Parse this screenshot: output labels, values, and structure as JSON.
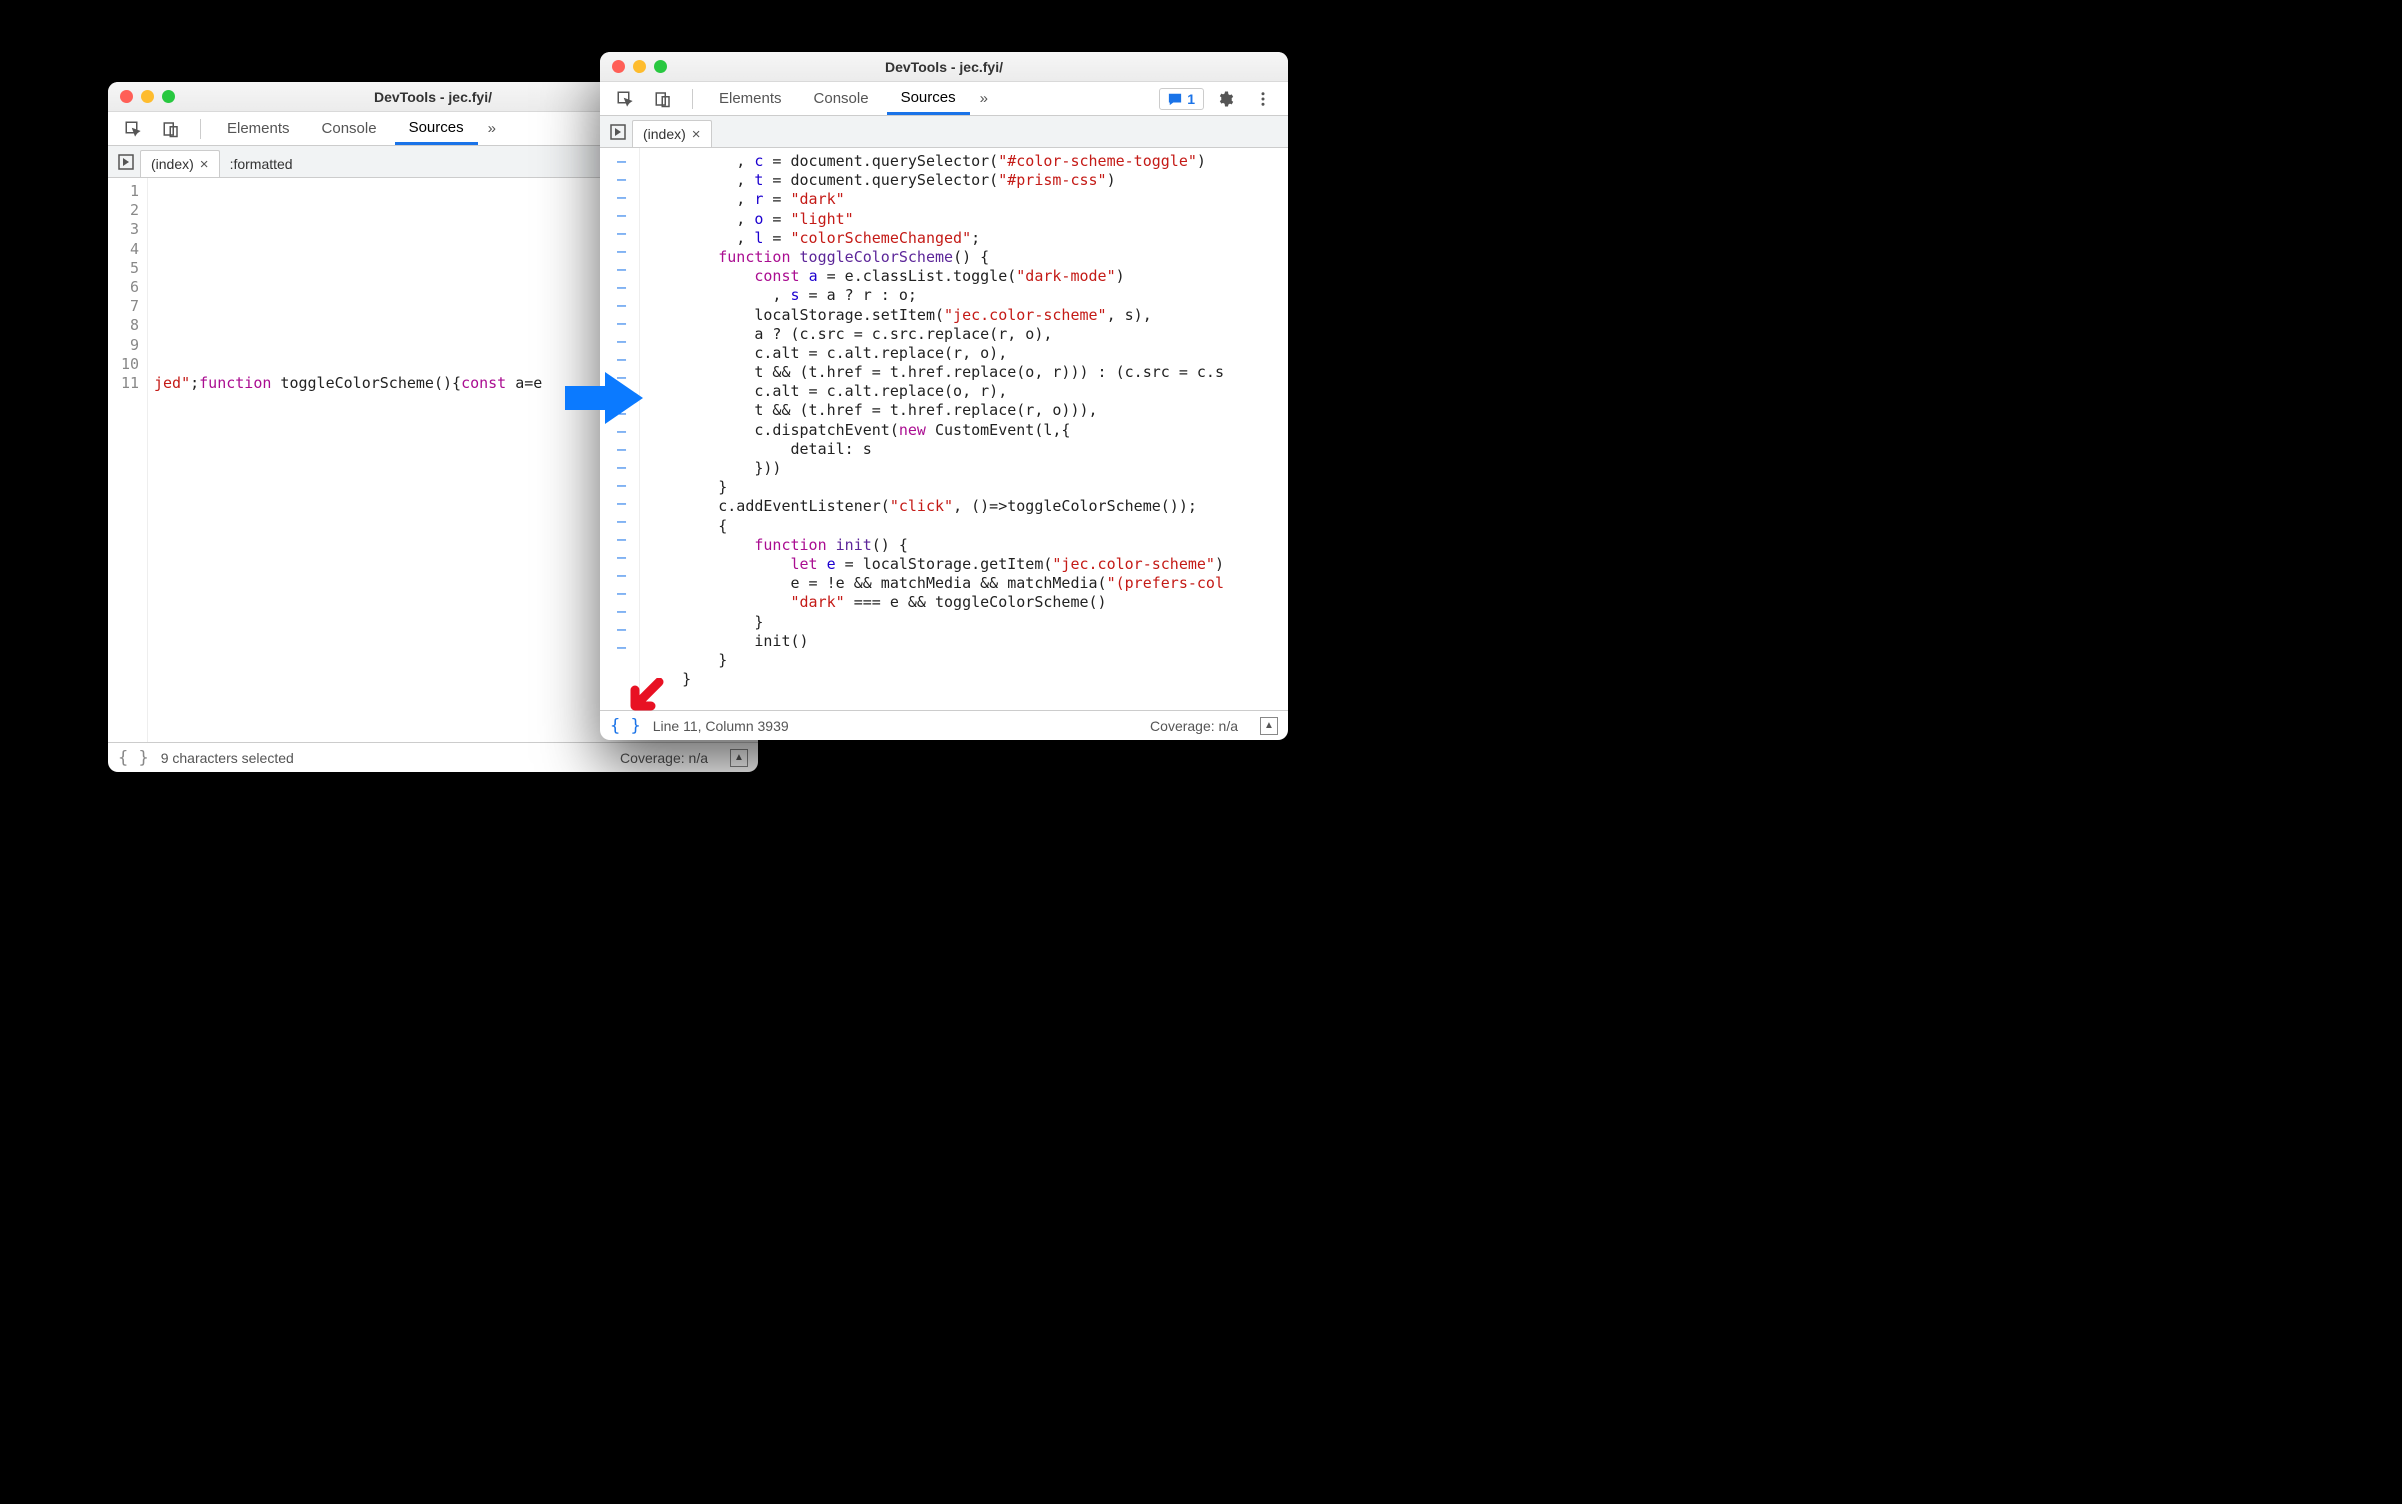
{
  "windows": {
    "left": {
      "title": "DevTools - jec.fyi/",
      "tabs": [
        "Elements",
        "Console",
        "Sources"
      ],
      "activeTab": "Sources",
      "fileTabs": [
        {
          "label": "(index)",
          "closable": true,
          "active": true
        },
        {
          "label": ":formatted",
          "closable": false,
          "active": false
        }
      ],
      "gutter": [
        "1",
        "2",
        "3",
        "4",
        "5",
        "6",
        "7",
        "8",
        "9",
        "10",
        "11"
      ],
      "line11_parts": {
        "p1": "jed\"",
        "p2": ";",
        "kw1": "function",
        "fn": " toggleColorScheme(){",
        "kw2": "const",
        "p3": " a=e"
      },
      "status": {
        "selected": "9 characters selected",
        "coverage": "Coverage: n/a"
      }
    },
    "right": {
      "title": "DevTools - jec.fyi/",
      "tabs": [
        "Elements",
        "Console",
        "Sources"
      ],
      "activeTab": "Sources",
      "issueCount": "1",
      "fileTabs": [
        {
          "label": "(index)",
          "closable": true,
          "active": true
        }
      ],
      "code_lines": [
        [
          [
            "",
            "          , "
          ],
          [
            "ident",
            "c"
          ],
          [
            "",
            " = document.querySelector("
          ],
          [
            "str",
            "\"#color-scheme-toggle\""
          ],
          [
            "",
            ")"
          ]
        ],
        [
          [
            "",
            "          , "
          ],
          [
            "ident",
            "t"
          ],
          [
            "",
            " = document.querySelector("
          ],
          [
            "str",
            "\"#prism-css\""
          ],
          [
            "",
            ")"
          ]
        ],
        [
          [
            "",
            "          , "
          ],
          [
            "ident",
            "r"
          ],
          [
            "",
            " = "
          ],
          [
            "str",
            "\"dark\""
          ]
        ],
        [
          [
            "",
            "          , "
          ],
          [
            "ident",
            "o"
          ],
          [
            "",
            " = "
          ],
          [
            "str",
            "\"light\""
          ]
        ],
        [
          [
            "",
            "          , "
          ],
          [
            "ident",
            "l"
          ],
          [
            "",
            " = "
          ],
          [
            "str",
            "\"colorSchemeChanged\""
          ],
          [
            "",
            ";"
          ]
        ],
        [
          [
            "",
            "        "
          ],
          [
            "kw",
            "function"
          ],
          [
            "",
            " "
          ],
          [
            "prop",
            "toggleColorScheme"
          ],
          [
            "",
            "() {"
          ]
        ],
        [
          [
            "",
            "            "
          ],
          [
            "kw",
            "const"
          ],
          [
            "",
            " "
          ],
          [
            "ident",
            "a"
          ],
          [
            "",
            " = e.classList.toggle("
          ],
          [
            "str",
            "\"dark-mode\""
          ],
          [
            "",
            ")"
          ]
        ],
        [
          [
            "",
            "              , "
          ],
          [
            "ident",
            "s"
          ],
          [
            "",
            " = a ? r : o;"
          ]
        ],
        [
          [
            "",
            "            localStorage.setItem("
          ],
          [
            "str",
            "\"jec.color-scheme\""
          ],
          [
            "",
            ", s),"
          ]
        ],
        [
          [
            "",
            "            a ? (c.src = c.src.replace(r, o),"
          ]
        ],
        [
          [
            "",
            "            c.alt = c.alt.replace(r, o),"
          ]
        ],
        [
          [
            "",
            "            t && (t.href = t.href.replace(o, r))) : (c.src = c.s"
          ]
        ],
        [
          [
            "",
            "            c.alt = c.alt.replace(o, r),"
          ]
        ],
        [
          [
            "",
            "            t && (t.href = t.href.replace(r, o))),"
          ]
        ],
        [
          [
            "",
            "            c.dispatchEvent("
          ],
          [
            "kw",
            "new"
          ],
          [
            "",
            " CustomEvent(l,{"
          ]
        ],
        [
          [
            "",
            "                detail: s"
          ]
        ],
        [
          [
            "",
            "            }))"
          ]
        ],
        [
          [
            "",
            "        }"
          ]
        ],
        [
          [
            "",
            "        c.addEventListener("
          ],
          [
            "str",
            "\"click\""
          ],
          [
            "",
            ", ()=>toggleColorScheme());"
          ]
        ],
        [
          [
            "",
            "        {"
          ]
        ],
        [
          [
            "",
            "            "
          ],
          [
            "kw",
            "function"
          ],
          [
            "",
            " "
          ],
          [
            "prop",
            "init"
          ],
          [
            "",
            "() {"
          ]
        ],
        [
          [
            "",
            "                "
          ],
          [
            "kw",
            "let"
          ],
          [
            "",
            " "
          ],
          [
            "ident",
            "e"
          ],
          [
            "",
            " = localStorage.getItem("
          ],
          [
            "str",
            "\"jec.color-scheme\""
          ],
          [
            "",
            ")"
          ]
        ],
        [
          [
            "",
            "                e = !e && matchMedia && matchMedia("
          ],
          [
            "str",
            "\"(prefers-col"
          ]
        ],
        [
          [
            "",
            "                "
          ],
          [
            "str",
            "\"dark\""
          ],
          [
            "",
            " === e && toggleColorScheme()"
          ]
        ],
        [
          [
            "",
            "            }"
          ]
        ],
        [
          [
            "",
            "            init()"
          ]
        ],
        [
          [
            "",
            "        }"
          ]
        ],
        [
          [
            "",
            "    }"
          ]
        ]
      ],
      "status": {
        "position": "Line 11, Column 3939",
        "coverage": "Coverage: n/a"
      }
    }
  }
}
